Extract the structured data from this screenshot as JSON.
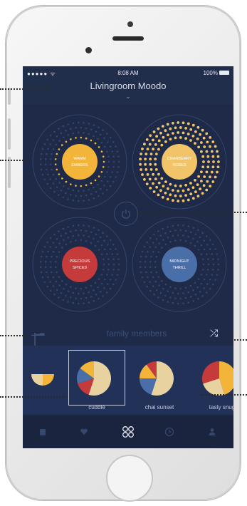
{
  "status": {
    "signal": "●●●●● ᯤ",
    "time": "8:08 AM",
    "battery": "100%"
  },
  "room": {
    "title": "Livingroom Moodo",
    "chevron": "⌄"
  },
  "scents": [
    {
      "label": "WARM\nEMBERS",
      "color": "#f2b53a"
    },
    {
      "label": "CRANBERRY\nROSES",
      "color": "#f2c46a"
    },
    {
      "label": "PRECIOUS\nSPICES",
      "color": "#c53a3a"
    },
    {
      "label": "MIDNIGHT\nTHRILL",
      "color": "#4a6fa8"
    }
  ],
  "family_label": "family members",
  "blends": [
    {
      "label": "cuddle"
    },
    {
      "label": "chai sunset"
    },
    {
      "label": "tasty snug"
    }
  ],
  "tabs": [
    "capsule-icon",
    "heart-icon",
    "family-icon",
    "clock-icon",
    "profile-icon"
  ],
  "colors": {
    "bg": "#1e2a47",
    "accent": "#f2b53a",
    "red": "#c53a3a",
    "blue": "#4a6fa8",
    "cream": "#e8d3a0"
  }
}
